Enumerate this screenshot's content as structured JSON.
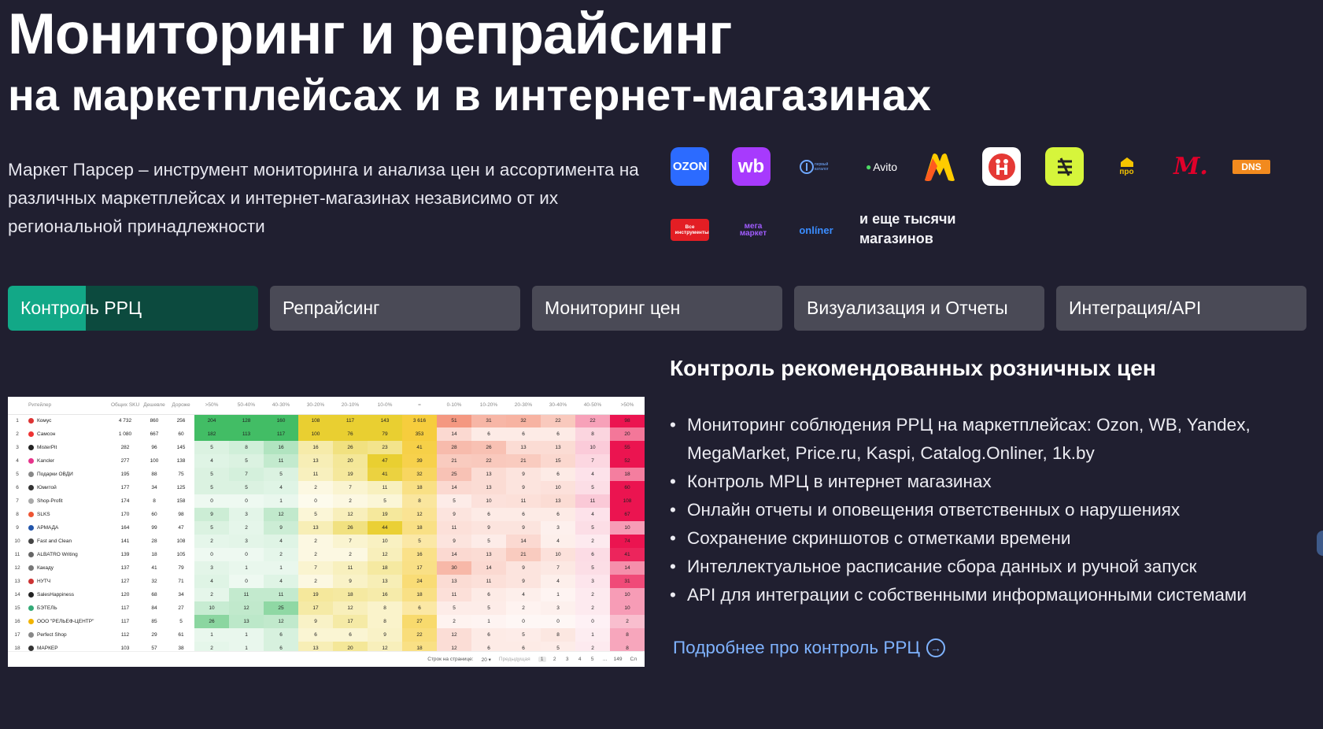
{
  "hero": {
    "title": "Мониторинг и репрайсинг",
    "subtitle": "на маркетплейсах и в интернет-магазинах",
    "description": "Маркет Парсер – инструмент мониторинга и анализа цен и ассортимента на различных маркетплейсах и интернет-магазинах независимо от их региональной принадлежности"
  },
  "logos": {
    "items": [
      {
        "name": "ozon",
        "text": "OZON",
        "bg": "#2c6bff",
        "fg": "#ffffff"
      },
      {
        "name": "wildberries",
        "text": "wb",
        "bg": "#a73afd",
        "fg": "#ffffff"
      },
      {
        "name": "perviy-katalog",
        "text": "первый каталог",
        "bg": "transparent",
        "fg": "#6fa8ff"
      },
      {
        "name": "avito",
        "text": "Avito",
        "bg": "transparent",
        "fg": "#ffffff"
      },
      {
        "name": "yandex-market",
        "text": "",
        "bg": "transparent",
        "fg": "#ffcc00"
      },
      {
        "name": "detsky-mir",
        "text": "",
        "bg": "#ffffff",
        "fg": "#e53935"
      },
      {
        "name": "lemana-pro",
        "text": "",
        "bg": "#d6f53b",
        "fg": "#222222"
      },
      {
        "name": "pro-logo",
        "text": "про",
        "bg": "transparent",
        "fg": "#f5c400"
      },
      {
        "name": "m-video",
        "text": "М.",
        "bg": "transparent",
        "fg": "#e0002a"
      },
      {
        "name": "dns",
        "text": "DNS",
        "bg": "#f28a1e",
        "fg": "#ffffff"
      },
      {
        "name": "vseinstrumenti",
        "text": "Все инструменты",
        "bg": "#e31e24",
        "fg": "#ffffff"
      },
      {
        "name": "megamarket",
        "text": "мега маркет",
        "bg": "transparent",
        "fg": "#a15cff"
      },
      {
        "name": "onliner",
        "text": "onlíner",
        "bg": "transparent",
        "fg": "#3a8dff"
      }
    ],
    "more_text": "и еще тысячи магазинов"
  },
  "tabs": [
    {
      "label": "Контроль РРЦ",
      "active": true,
      "progress": 0.31
    },
    {
      "label": "Репрайсинг",
      "active": false
    },
    {
      "label": "Мониторинг цен",
      "active": false
    },
    {
      "label": "Визуализация и Отчеты",
      "active": false
    },
    {
      "label": "Интеграция/API",
      "active": false
    }
  ],
  "content": {
    "title": "Контроль рекомендованных розничных цен",
    "bullets": [
      "Мониторинг соблюдения РРЦ на маркетплейсах: Ozon, WB, Yandex, MegaMarket, Price.ru, Kaspi, Catalog.Onliner, 1k.by",
      "Контроль МРЦ в интернет магазинах",
      "Онлайн отчеты и оповещения ответственных о нарушениях",
      "Сохранение скриншотов с отметками времени",
      "Интеллектуальное расписание сбора данных и ручной запуск",
      "API для интеграции с собственными информационными системами"
    ],
    "more_link": "Подробнее про контроль РРЦ"
  },
  "screenshot_table": {
    "headers": [
      "",
      "Ритейлер",
      "Общих SKU",
      "Дешевле",
      "Дороже",
      ">50%",
      "50-40%",
      "40-30%",
      "30-20%",
      "20-10%",
      "10-0%",
      "=",
      "0-10%",
      "10-20%",
      "20-30%",
      "30-40%",
      "40-50%",
      ">50%"
    ],
    "rows": [
      [
        "1",
        "Комус",
        "4 732",
        "860",
        "256",
        "204",
        "128",
        "160",
        "108",
        "117",
        "143",
        "3 616",
        "51",
        "31",
        "32",
        "22",
        "22",
        "98"
      ],
      [
        "2",
        "Самсон",
        "1 080",
        "667",
        "60",
        "182",
        "113",
        "117",
        "100",
        "76",
        "79",
        "353",
        "14",
        "6",
        "6",
        "6",
        "8",
        "20"
      ],
      [
        "3",
        "MisterPit",
        "282",
        "96",
        "145",
        "5",
        "8",
        "16",
        "16",
        "26",
        "23",
        "41",
        "28",
        "26",
        "13",
        "13",
        "10",
        "55"
      ],
      [
        "4",
        "Kancler",
        "277",
        "100",
        "138",
        "4",
        "5",
        "11",
        "13",
        "20",
        "47",
        "39",
        "21",
        "22",
        "21",
        "15",
        "7",
        "52"
      ],
      [
        "5",
        "Подарки ОВДИ",
        "195",
        "88",
        "75",
        "5",
        "7",
        "5",
        "11",
        "19",
        "41",
        "32",
        "25",
        "13",
        "9",
        "6",
        "4",
        "18"
      ],
      [
        "6",
        "Юмитой",
        "177",
        "34",
        "125",
        "5",
        "5",
        "4",
        "2",
        "7",
        "11",
        "18",
        "14",
        "13",
        "9",
        "10",
        "5",
        "60"
      ],
      [
        "7",
        "Shop-Profit",
        "174",
        "8",
        "158",
        "0",
        "0",
        "1",
        "0",
        "2",
        "5",
        "8",
        "5",
        "10",
        "11",
        "13",
        "11",
        "108"
      ],
      [
        "8",
        "SLKS",
        "170",
        "60",
        "98",
        "9",
        "3",
        "12",
        "5",
        "12",
        "19",
        "12",
        "9",
        "6",
        "6",
        "6",
        "4",
        "67"
      ],
      [
        "9",
        "АРМАДА",
        "164",
        "99",
        "47",
        "5",
        "2",
        "9",
        "13",
        "26",
        "44",
        "18",
        "11",
        "9",
        "9",
        "3",
        "5",
        "10"
      ],
      [
        "10",
        "Fast and Clean",
        "141",
        "28",
        "108",
        "2",
        "3",
        "4",
        "2",
        "7",
        "10",
        "5",
        "9",
        "5",
        "14",
        "4",
        "2",
        "74"
      ],
      [
        "11",
        "ALBATRO Writing",
        "139",
        "18",
        "105",
        "0",
        "0",
        "2",
        "2",
        "2",
        "12",
        "16",
        "14",
        "13",
        "21",
        "10",
        "6",
        "41"
      ],
      [
        "12",
        "Какаду",
        "137",
        "41",
        "79",
        "3",
        "1",
        "1",
        "7",
        "11",
        "18",
        "17",
        "30",
        "14",
        "9",
        "7",
        "5",
        "14"
      ],
      [
        "13",
        "НУТЧ",
        "127",
        "32",
        "71",
        "4",
        "0",
        "4",
        "2",
        "9",
        "13",
        "24",
        "13",
        "11",
        "9",
        "4",
        "3",
        "31"
      ],
      [
        "14",
        "SalesHappiness",
        "120",
        "68",
        "34",
        "2",
        "11",
        "11",
        "19",
        "18",
        "16",
        "18",
        "11",
        "6",
        "4",
        "1",
        "2",
        "10"
      ],
      [
        "15",
        "БЭТЕЛЬ",
        "117",
        "84",
        "27",
        "10",
        "12",
        "25",
        "17",
        "12",
        "8",
        "6",
        "5",
        "5",
        "2",
        "3",
        "2",
        "10"
      ],
      [
        "16",
        "ООО \"РЕЛЬЕФ-ЦЕНТР\"",
        "117",
        "85",
        "5",
        "26",
        "13",
        "12",
        "9",
        "17",
        "8",
        "27",
        "2",
        "1",
        "0",
        "0",
        "0",
        "2"
      ],
      [
        "17",
        "Perfect Shop",
        "112",
        "29",
        "61",
        "1",
        "1",
        "6",
        "6",
        "6",
        "9",
        "22",
        "12",
        "6",
        "5",
        "8",
        "1",
        "8"
      ],
      [
        "18",
        "МАРКЕР",
        "103",
        "57",
        "38",
        "2",
        "1",
        "6",
        "13",
        "20",
        "12",
        "18",
        "12",
        "6",
        "6",
        "5",
        "2",
        "8"
      ]
    ],
    "pager": {
      "rows_label": "Строк на странице:",
      "rows_value": "20",
      "prev": "Предыдущая",
      "pages": [
        "1",
        "2",
        "3",
        "4",
        "5",
        "...",
        "149"
      ],
      "next": "Сл"
    }
  },
  "colors": {
    "background": "#201f30",
    "tab_inactive": "#4a4a56",
    "tab_active": "#0c4a3e",
    "tab_progress": "#12a887",
    "link": "#7fb3ff"
  }
}
